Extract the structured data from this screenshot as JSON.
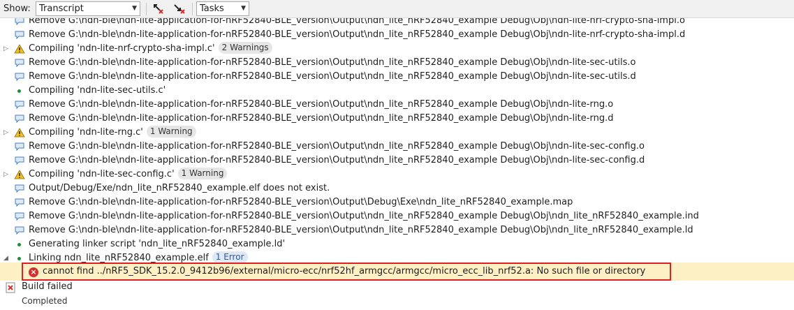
{
  "toolbar": {
    "show_label": "Show:",
    "show_value": "Transcript",
    "tasks_value": "Tasks",
    "prev_button_icon": "go-to-previous-error-icon",
    "next_button_icon": "go-to-next-error-icon"
  },
  "colors": {
    "error_bg": "#fdf0c4",
    "error_border": "#e02020",
    "warning": "#f0c020",
    "success_bullet": "#1e8c3c"
  },
  "log": [
    {
      "icon": "message",
      "text": "Remove G:\\ndn-ble\\ndn-lite-application-for-nRF52840-BLE_version\\Output\\ndn_lite_nRF52840_example Debug\\Obj\\ndn-lite-nrf-crypto-sha-impl.o"
    },
    {
      "icon": "message",
      "text": "Remove G:\\ndn-ble\\ndn-lite-application-for-nRF52840-BLE_version\\Output\\ndn_lite_nRF52840_example Debug\\Obj\\ndn-lite-nrf-crypto-sha-impl.d"
    },
    {
      "icon": "warning",
      "expand": "▷",
      "text": "Compiling 'ndn-lite-nrf-crypto-sha-impl.c'",
      "badge": "2 Warnings"
    },
    {
      "icon": "message",
      "text": "Remove G:\\ndn-ble\\ndn-lite-application-for-nRF52840-BLE_version\\Output\\ndn_lite_nRF52840_example Debug\\Obj\\ndn-lite-sec-utils.o"
    },
    {
      "icon": "message",
      "text": "Remove G:\\ndn-ble\\ndn-lite-application-for-nRF52840-BLE_version\\Output\\ndn_lite_nRF52840_example Debug\\Obj\\ndn-lite-sec-utils.d"
    },
    {
      "icon": "bullet",
      "text": "Compiling 'ndn-lite-sec-utils.c'"
    },
    {
      "icon": "message",
      "text": "Remove G:\\ndn-ble\\ndn-lite-application-for-nRF52840-BLE_version\\Output\\ndn_lite_nRF52840_example Debug\\Obj\\ndn-lite-rng.o"
    },
    {
      "icon": "message",
      "text": "Remove G:\\ndn-ble\\ndn-lite-application-for-nRF52840-BLE_version\\Output\\ndn_lite_nRF52840_example Debug\\Obj\\ndn-lite-rng.d"
    },
    {
      "icon": "warning",
      "expand": "▷",
      "text": "Compiling 'ndn-lite-rng.c'",
      "badge": "1 Warning"
    },
    {
      "icon": "message",
      "text": "Remove G:\\ndn-ble\\ndn-lite-application-for-nRF52840-BLE_version\\Output\\ndn_lite_nRF52840_example Debug\\Obj\\ndn-lite-sec-config.o"
    },
    {
      "icon": "message",
      "text": "Remove G:\\ndn-ble\\ndn-lite-application-for-nRF52840-BLE_version\\Output\\ndn_lite_nRF52840_example Debug\\Obj\\ndn-lite-sec-config.d"
    },
    {
      "icon": "warning",
      "expand": "▷",
      "text": "Compiling 'ndn-lite-sec-config.c'",
      "badge": "1 Warning"
    },
    {
      "icon": "message",
      "text": "Output/Debug/Exe/ndn_lite_nRF52840_example.elf does not exist."
    },
    {
      "icon": "message",
      "text": "Remove G:\\ndn-ble\\ndn-lite-application-for-nRF52840-BLE_version\\Output\\Debug\\Exe\\ndn_lite_nRF52840_example.map"
    },
    {
      "icon": "message",
      "text": "Remove G:\\ndn-ble\\ndn-lite-application-for-nRF52840-BLE_version\\Output\\ndn_lite_nRF52840_example Debug\\Obj\\ndn_lite_nRF52840_example.ind"
    },
    {
      "icon": "message",
      "text": "Remove G:\\ndn-ble\\ndn-lite-application-for-nRF52840-BLE_version\\Output\\ndn_lite_nRF52840_example Debug\\Obj\\ndn_lite_nRF52840_example.ld"
    },
    {
      "icon": "bullet",
      "text": "Generating linker script 'ndn_lite_nRF52840_example.ld'"
    },
    {
      "icon": "bullet",
      "expand": "◢",
      "text": "Linking ndn_lite_nRF52840_example.elf",
      "badge": "1 Error"
    }
  ],
  "error": {
    "text": "cannot find ../nRF5_SDK_15.2.0_9412b96/external/micro-ecc/nrf52hf_armgcc/armgcc/micro_ecc_lib_nrf52.a: No such file or directory"
  },
  "footer": {
    "status": "Build failed",
    "completed": "Completed"
  }
}
